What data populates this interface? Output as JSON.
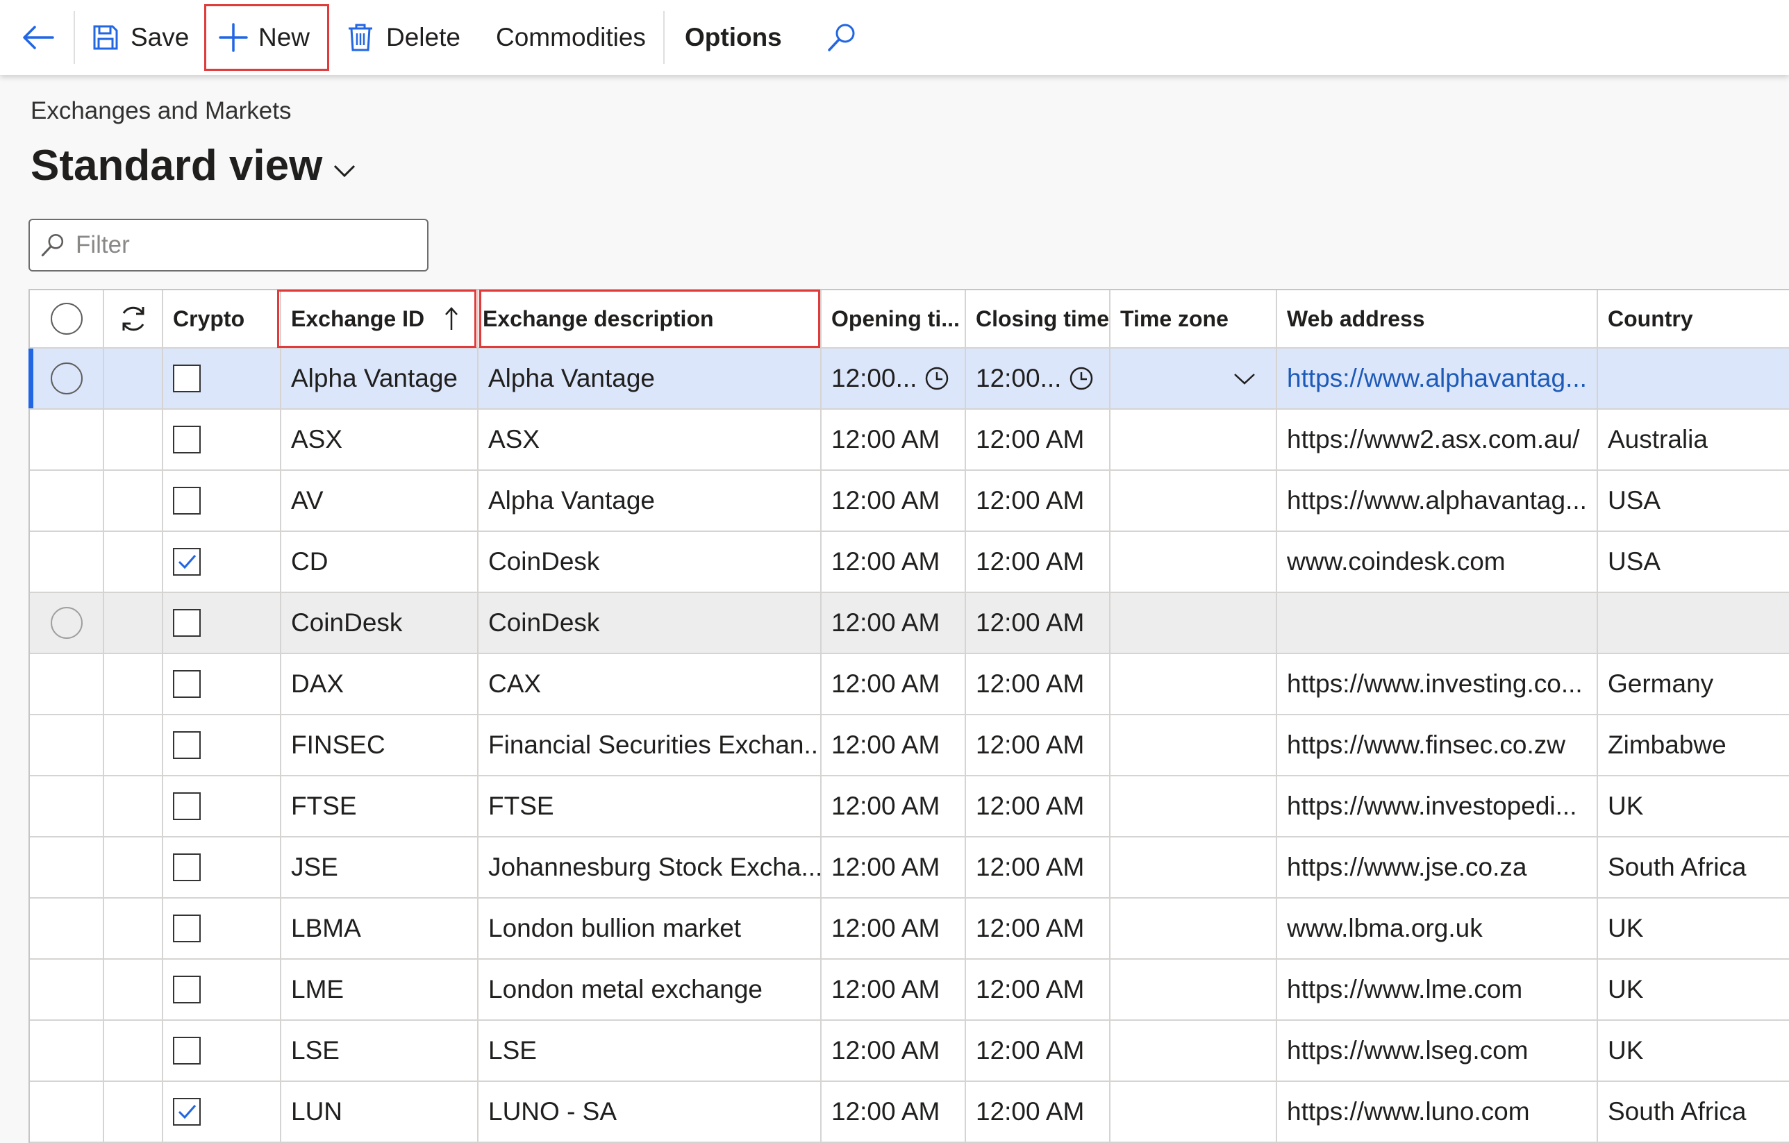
{
  "toolbar": {
    "save": "Save",
    "new": "New",
    "delete": "Delete",
    "commodities": "Commodities",
    "options": "Options",
    "icons": [
      "back-arrow-icon",
      "save-icon",
      "plus-icon",
      "delete-icon",
      "search-icon"
    ]
  },
  "breadcrumb": "Exchanges and Markets",
  "view_title": "Standard view",
  "filter": {
    "placeholder": "Filter"
  },
  "grid": {
    "columns": {
      "crypto": "Crypto",
      "exchange_id": "Exchange ID",
      "exchange_description": "Exchange description",
      "opening_time": "Opening ti...",
      "closing_time": "Closing time",
      "time_zone": "Time zone",
      "web_address": "Web address",
      "country": "Country"
    },
    "rows": [
      {
        "crypto": false,
        "id": "Alpha Vantage",
        "desc": "Alpha Vantage",
        "open": "12:00...",
        "close": "12:00...",
        "tz": "",
        "web": "https://www.alphavantag...",
        "country": ""
      },
      {
        "crypto": false,
        "id": "ASX",
        "desc": "ASX",
        "open": "12:00 AM",
        "close": "12:00 AM",
        "tz": "",
        "web": "https://www2.asx.com.au/",
        "country": "Australia"
      },
      {
        "crypto": false,
        "id": "AV",
        "desc": "Alpha Vantage",
        "open": "12:00 AM",
        "close": "12:00 AM",
        "tz": "",
        "web": "https://www.alphavantag...",
        "country": "USA"
      },
      {
        "crypto": true,
        "id": "CD",
        "desc": "CoinDesk",
        "open": "12:00 AM",
        "close": "12:00 AM",
        "tz": "",
        "web": "www.coindesk.com",
        "country": "USA"
      },
      {
        "crypto": false,
        "id": "CoinDesk",
        "desc": "CoinDesk",
        "open": "12:00 AM",
        "close": "12:00 AM",
        "tz": "",
        "web": "",
        "country": ""
      },
      {
        "crypto": false,
        "id": "DAX",
        "desc": "CAX",
        "open": "12:00 AM",
        "close": "12:00 AM",
        "tz": "",
        "web": "https://www.investing.co...",
        "country": "Germany"
      },
      {
        "crypto": false,
        "id": "FINSEC",
        "desc": "Financial Securities Exchan...",
        "open": "12:00 AM",
        "close": "12:00 AM",
        "tz": "",
        "web": "https://www.finsec.co.zw",
        "country": "Zimbabwe"
      },
      {
        "crypto": false,
        "id": "FTSE",
        "desc": "FTSE",
        "open": "12:00 AM",
        "close": "12:00 AM",
        "tz": "",
        "web": "https://www.investopedi...",
        "country": "UK"
      },
      {
        "crypto": false,
        "id": "JSE",
        "desc": "Johannesburg Stock Excha...",
        "open": "12:00 AM",
        "close": "12:00 AM",
        "tz": "",
        "web": "https://www.jse.co.za",
        "country": "South Africa"
      },
      {
        "crypto": false,
        "id": "LBMA",
        "desc": "London bullion market",
        "open": "12:00 AM",
        "close": "12:00 AM",
        "tz": "",
        "web": "www.lbma.org.uk",
        "country": "UK"
      },
      {
        "crypto": false,
        "id": "LME",
        "desc": "London metal exchange",
        "open": "12:00 AM",
        "close": "12:00 AM",
        "tz": "",
        "web": "https://www.lme.com",
        "country": "UK"
      },
      {
        "crypto": false,
        "id": "LSE",
        "desc": "LSE",
        "open": "12:00 AM",
        "close": "12:00 AM",
        "tz": "",
        "web": "https://www.lseg.com",
        "country": "UK"
      },
      {
        "crypto": true,
        "id": "LUN",
        "desc": "LUNO - SA",
        "open": "12:00 AM",
        "close": "12:00 AM",
        "tz": "",
        "web": "https://www.luno.com",
        "country": "South Africa"
      }
    ]
  },
  "colors": {
    "accent": "#2266e3",
    "selected_row": "#dbe6fb",
    "highlight_box": "#e03a3a",
    "link": "#1d5ab8"
  }
}
